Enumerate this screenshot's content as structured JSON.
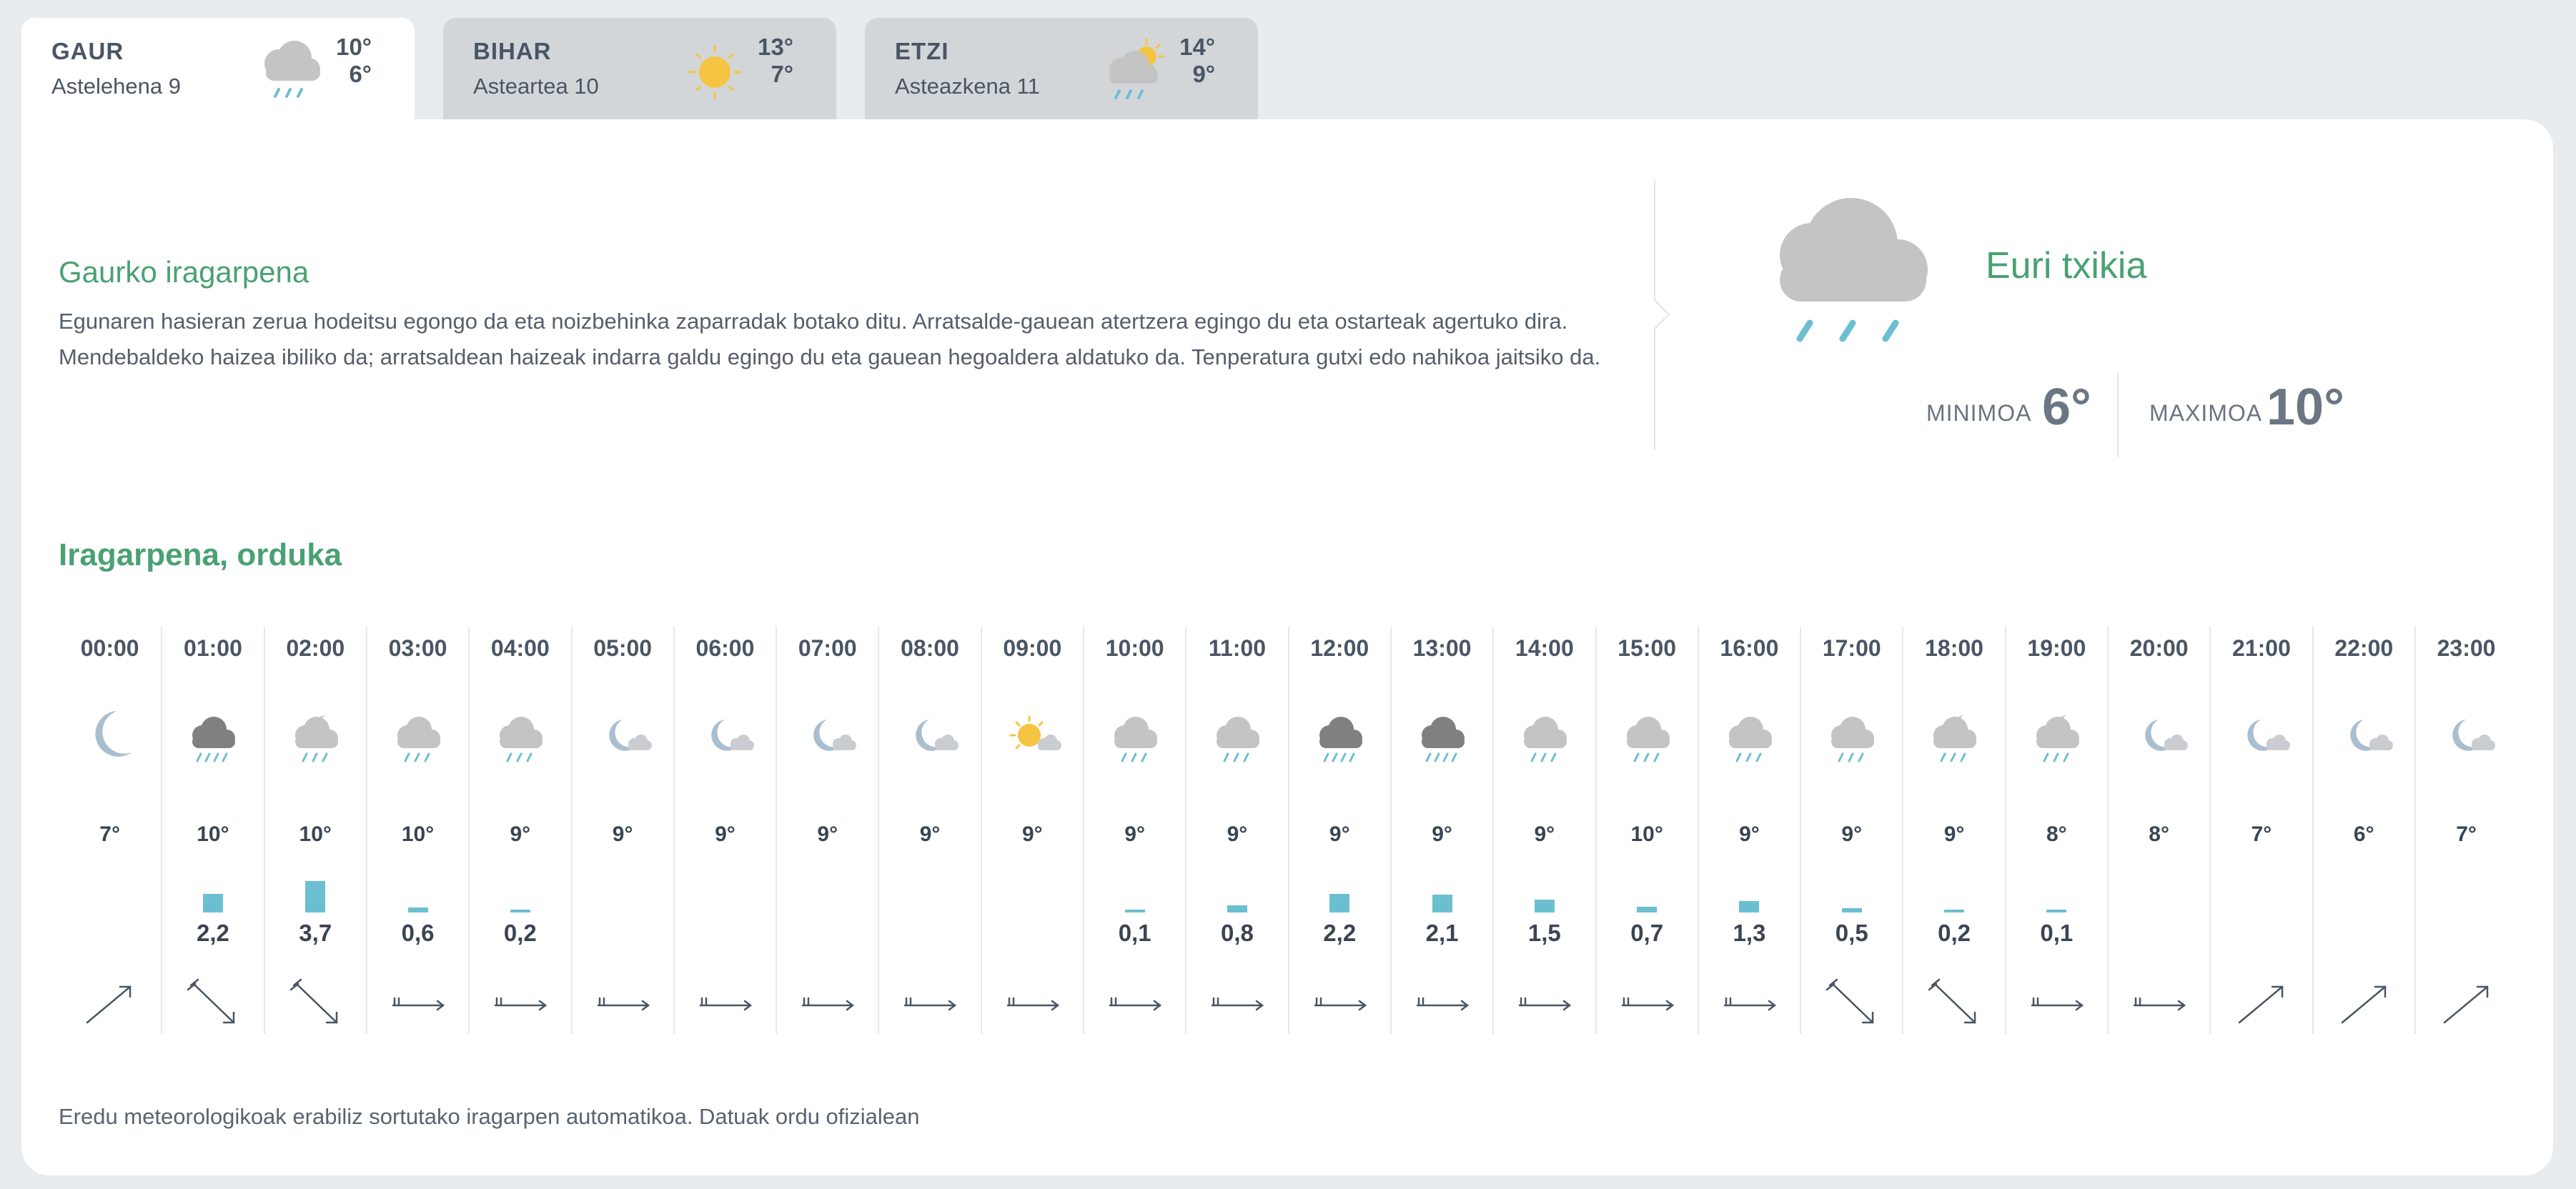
{
  "tabs": [
    {
      "name": "GAUR",
      "date": "Astelehena 9",
      "max": "10°",
      "min": "6°",
      "icon": "cloud-rain-icon",
      "active": true
    },
    {
      "name": "BIHAR",
      "date": "Asteartea 10",
      "max": "13°",
      "min": "7°",
      "icon": "sun-icon",
      "active": false
    },
    {
      "name": "ETZI",
      "date": "Asteazkena 11",
      "max": "14°",
      "min": "9°",
      "icon": "cloud-sun-rain-icon",
      "active": false
    }
  ],
  "today": {
    "title": "Gaurko iragarpena",
    "text": "Egunaren hasieran zerua hodeitsu egongo da eta noizbehinka zaparradak botako ditu. Arratsalde-gauean atertzera egingo du eta ostarteak agertuko dira. Mendebaldeko haizea ibiliko da; arratsaldean haizeak indarra galdu egingo du eta gauean hegoaldera aldatuko da. Tenperatura gutxi edo nahikoa jaitsiko da.",
    "condition": "Euri txikia",
    "condition_icon": "cloud-rain-icon",
    "min_label": "MINIMOA",
    "min_value": "6°",
    "max_label": "MAXIMOA",
    "max_value": "10°"
  },
  "hourly": {
    "title": "Iragarpena, orduka",
    "hours": [
      {
        "time": "00:00",
        "icon": "moon-icon",
        "temp": "7°",
        "precip": "",
        "wind": "arrow-up-right-icon"
      },
      {
        "time": "01:00",
        "icon": "dark-cloud-heavy-rain-icon",
        "temp": "10°",
        "precip": "2,2",
        "wind": "arrow-down-right-icon"
      },
      {
        "time": "02:00",
        "icon": "moon-cloud-rain-icon",
        "temp": "10°",
        "precip": "3,7",
        "wind": "arrow-down-right-icon"
      },
      {
        "time": "03:00",
        "icon": "cloud-rain-icon",
        "temp": "10°",
        "precip": "0,6",
        "wind": "arrow-right-icon"
      },
      {
        "time": "04:00",
        "icon": "cloud-rain-icon",
        "temp": "9°",
        "precip": "0,2",
        "wind": "arrow-right-icon"
      },
      {
        "time": "05:00",
        "icon": "moon-cloud-icon",
        "temp": "9°",
        "precip": "",
        "wind": "arrow-right-icon"
      },
      {
        "time": "06:00",
        "icon": "moon-cloud-icon",
        "temp": "9°",
        "precip": "",
        "wind": "arrow-right-icon"
      },
      {
        "time": "07:00",
        "icon": "moon-cloud-icon",
        "temp": "9°",
        "precip": "",
        "wind": "arrow-right-icon"
      },
      {
        "time": "08:00",
        "icon": "moon-cloud-icon",
        "temp": "9°",
        "precip": "",
        "wind": "arrow-right-icon"
      },
      {
        "time": "09:00",
        "icon": "sun-cloud-icon",
        "temp": "9°",
        "precip": "",
        "wind": "arrow-right-icon"
      },
      {
        "time": "10:00",
        "icon": "cloud-rain-icon",
        "temp": "9°",
        "precip": "0,1",
        "wind": "arrow-right-icon"
      },
      {
        "time": "11:00",
        "icon": "cloud-rain-icon",
        "temp": "9°",
        "precip": "0,8",
        "wind": "arrow-right-icon"
      },
      {
        "time": "12:00",
        "icon": "dark-cloud-heavy-rain-icon",
        "temp": "9°",
        "precip": "2,2",
        "wind": "arrow-right-icon"
      },
      {
        "time": "13:00",
        "icon": "dark-cloud-heavy-rain-icon",
        "temp": "9°",
        "precip": "2,1",
        "wind": "arrow-right-icon"
      },
      {
        "time": "14:00",
        "icon": "cloud-rain-icon",
        "temp": "9°",
        "precip": "1,5",
        "wind": "arrow-right-icon"
      },
      {
        "time": "15:00",
        "icon": "cloud-rain-icon",
        "temp": "10°",
        "precip": "0,7",
        "wind": "arrow-right-icon"
      },
      {
        "time": "16:00",
        "icon": "cloud-rain-icon",
        "temp": "9°",
        "precip": "1,3",
        "wind": "arrow-right-icon"
      },
      {
        "time": "17:00",
        "icon": "cloud-rain-icon",
        "temp": "9°",
        "precip": "0,5",
        "wind": "arrow-down-right-icon"
      },
      {
        "time": "18:00",
        "icon": "moon-cloud-rain-icon",
        "temp": "9°",
        "precip": "0,2",
        "wind": "arrow-down-right-icon"
      },
      {
        "time": "19:00",
        "icon": "moon-cloud-rain-icon",
        "temp": "8°",
        "precip": "0,1",
        "wind": "arrow-right-icon"
      },
      {
        "time": "20:00",
        "icon": "moon-cloud-icon",
        "temp": "8°",
        "precip": "",
        "wind": "arrow-right-icon"
      },
      {
        "time": "21:00",
        "icon": "moon-cloud-icon",
        "temp": "7°",
        "precip": "",
        "wind": "arrow-up-right-icon"
      },
      {
        "time": "22:00",
        "icon": "moon-cloud-icon",
        "temp": "6°",
        "precip": "",
        "wind": "arrow-up-right-icon"
      },
      {
        "time": "23:00",
        "icon": "moon-cloud-icon",
        "temp": "7°",
        "precip": "",
        "wind": "arrow-up-right-icon"
      }
    ]
  },
  "footnote": "Eredu meteorologikoak erabiliz sortutako iragarpen automatikoa. Datuak ordu ofizialean",
  "colors": {
    "accent": "#4aa173",
    "rain": "#6cbfd1",
    "cloud": "#c4c4c4",
    "dark_cloud": "#808080",
    "sun": "#f5c542",
    "moon": "#a9bfcf"
  }
}
